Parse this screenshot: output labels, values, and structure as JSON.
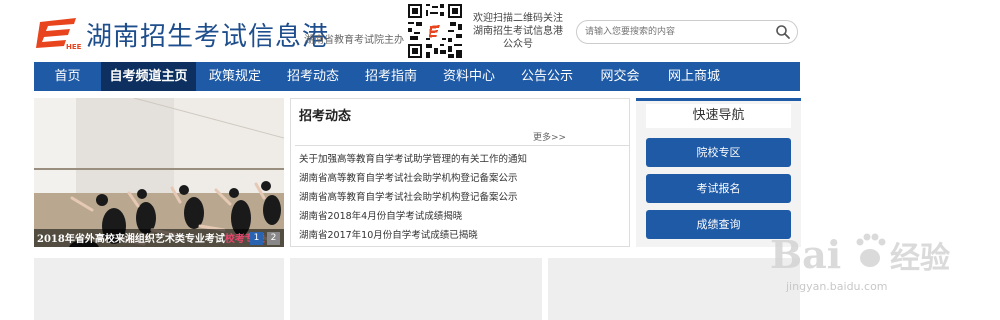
{
  "header": {
    "site_title": "湖南招生考试信息港",
    "site_subtitle": "湖南省教育考试院主办",
    "qr_text": "欢迎扫描二维码关注湖南招生考试信息港公众号",
    "search_placeholder": "请输入您要搜索的内容"
  },
  "nav": {
    "items": [
      {
        "label": "首页"
      },
      {
        "label": "自考频道主页"
      },
      {
        "label": "政策规定"
      },
      {
        "label": "招考动态"
      },
      {
        "label": "招考指南"
      },
      {
        "label": "资料中心"
      },
      {
        "label": "公告公示"
      },
      {
        "label": "网交会"
      },
      {
        "label": "网上商城"
      }
    ],
    "active_index": 1
  },
  "slider": {
    "caption": "2018年省外高校来湘组织艺术类专业考试",
    "caption_highlight": "校考专栏",
    "dots": [
      "1",
      "2"
    ],
    "active_dot": 0
  },
  "news": {
    "title": "招考动态",
    "more": "更多>>",
    "items": [
      "关于加强高等教育自学考试助学管理的有关工作的通知",
      "湖南省高等教育自学考试社会助学机构登记备案公示",
      "湖南省高等教育自学考试社会助学机构登记备案公示",
      "湖南省2018年4月份自学考试成绩揭晓",
      "湖南省2017年10月份自学考试成绩已揭晓"
    ]
  },
  "quick_nav": {
    "title": "快速导航",
    "buttons": [
      "院校专区",
      "考试报名",
      "成绩查询"
    ]
  },
  "watermark": {
    "text": "jingyan.baidu.com"
  },
  "colors": {
    "nav_bg": "#1f5aa6",
    "nav_active": "#0d3060",
    "brand_red": "#e8451e",
    "title_blue": "#1f4e8c"
  }
}
